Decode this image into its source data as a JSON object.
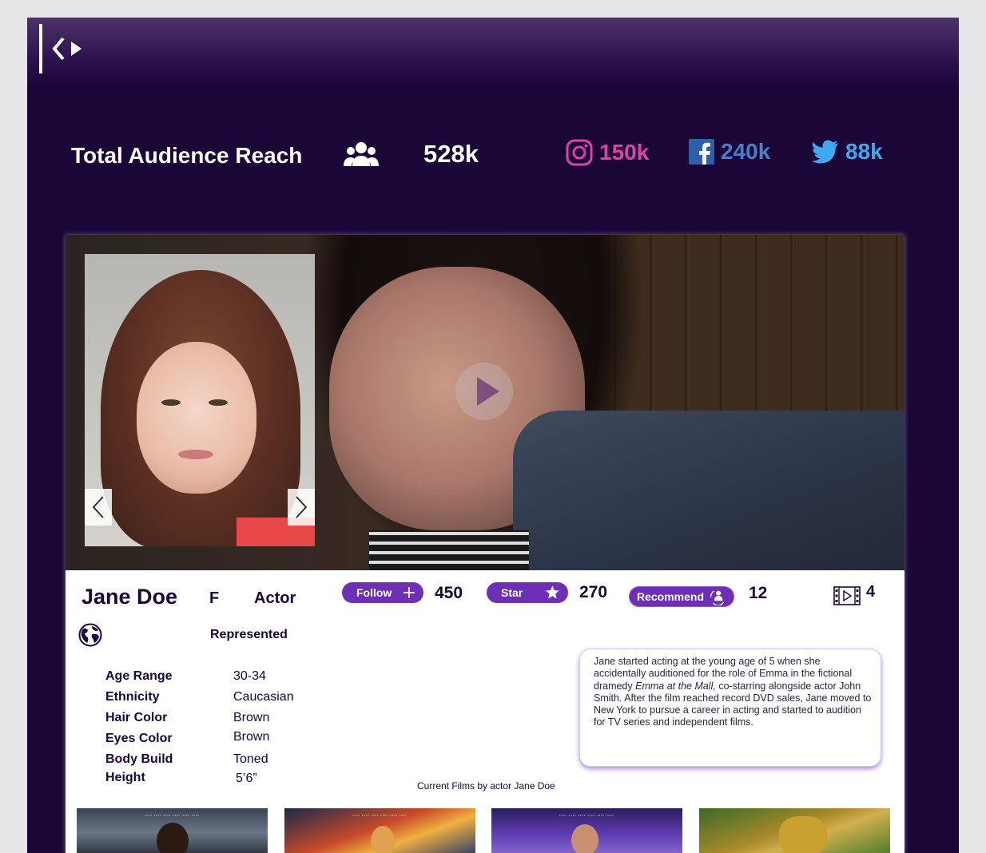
{
  "reach": {
    "title": "Total Audience Reach",
    "total": "528k",
    "instagram": "150k",
    "facebook": "240k",
    "twitter": "88k"
  },
  "profile": {
    "name": "Jane Doe",
    "gender": "F",
    "role": "Actor",
    "agency_status": "Represented",
    "follow_label": "Follow",
    "follow_count": "450",
    "star_label": "Star",
    "star_count": "270",
    "recommend_label": "Recommend",
    "recommend_count": "12",
    "films_count": "4"
  },
  "attributes": [
    {
      "label": "Age Range",
      "value": "30-34"
    },
    {
      "label": "Ethnicity",
      "value": "Caucasian"
    },
    {
      "label": "Hair Color",
      "value": "Brown"
    },
    {
      "label": "Eyes Color",
      "value": "Brown"
    },
    {
      "label": "Body Build",
      "value": "Toned"
    },
    {
      "label": "Height",
      "value": "5’6”"
    }
  ],
  "bio": {
    "part1": "Jane started acting at the young age of 5 when she accidentally auditioned for the role of Emma in the fictional dramedy ",
    "film_title": "Emma at the Mall, ",
    "part2": "co-starring alongside actor John Smith. After the film reached record DVD sales, Jane moved to New York to pursue a career in acting and started to audition for TV series and independent films."
  },
  "films_caption": "Current Films by actor Jane Doe",
  "colors": {
    "background": "#1b0638",
    "accent": "#6c2fb5",
    "instagram": "#e040a8",
    "facebook": "#4a7fc8",
    "twitter": "#3fa9f0"
  },
  "icons": [
    "logo-icon",
    "audience-icon",
    "instagram-icon",
    "facebook-icon",
    "twitter-icon",
    "plus-icon",
    "star-icon",
    "recommend-icon",
    "film-reel-icon",
    "globe-icon",
    "chevron-left-icon",
    "chevron-right-icon",
    "play-icon"
  ]
}
